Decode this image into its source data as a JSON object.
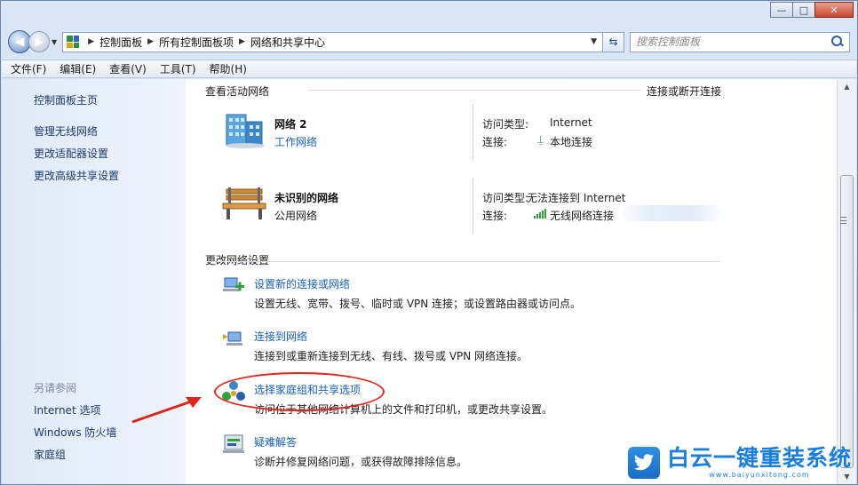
{
  "window": {
    "minimize_label": "—",
    "maximize_label": "□",
    "close_label": "✕"
  },
  "address": {
    "breadcrumbs": [
      "控制面板",
      "所有控制面板项",
      "网络和共享中心"
    ],
    "search_placeholder": "搜索控制面板"
  },
  "menubar": {
    "items": [
      "文件(F)",
      "编辑(E)",
      "查看(V)",
      "工具(T)",
      "帮助(H)"
    ]
  },
  "sidebar": {
    "links": [
      "控制面板主页",
      "管理无线网络",
      "更改适配器设置",
      "更改高级共享设置"
    ],
    "see_also_heading": "另请参阅",
    "see_also": [
      "Internet 选项",
      "Windows 防火墙",
      "家庭组"
    ]
  },
  "main": {
    "active_networks_title": "查看活动网络",
    "connect_disconnect": "连接或断开连接",
    "networks": [
      {
        "name": "网络  2",
        "type": "工作网络",
        "access_type_label": "访问类型:",
        "access_type_value": "Internet",
        "connection_label": "连接:",
        "connection_value": "本地连接"
      },
      {
        "name": "未识别的网络",
        "type": "公用网络",
        "access_type_label": "访问类型:",
        "access_type_value": "无法连接到 Internet",
        "connection_label": "连接:",
        "connection_value": "无线网络连接"
      }
    ],
    "change_settings_title": "更改网络设置",
    "tasks": [
      {
        "title": "设置新的连接或网络",
        "desc": "设置无线、宽带、拨号、临时或 VPN 连接；或设置路由器或访问点。"
      },
      {
        "title": "连接到网络",
        "desc": "连接到或重新连接到无线、有线、拨号或 VPN 网络连接。"
      },
      {
        "title": "选择家庭组和共享选项",
        "desc": "访问位于其他网络计算机上的文件和打印机，或更改共享设置。"
      },
      {
        "title": "疑难解答",
        "desc": "诊断并修复网络问题，或获得故障排除信息。"
      }
    ]
  },
  "watermark": {
    "title": "白云一键重装系统",
    "url": "www.baiyunxitong.com"
  },
  "colors": {
    "link": "#1660c0",
    "annotation_red": "#e0261c",
    "watermark_blue": "#1a7fdc"
  }
}
